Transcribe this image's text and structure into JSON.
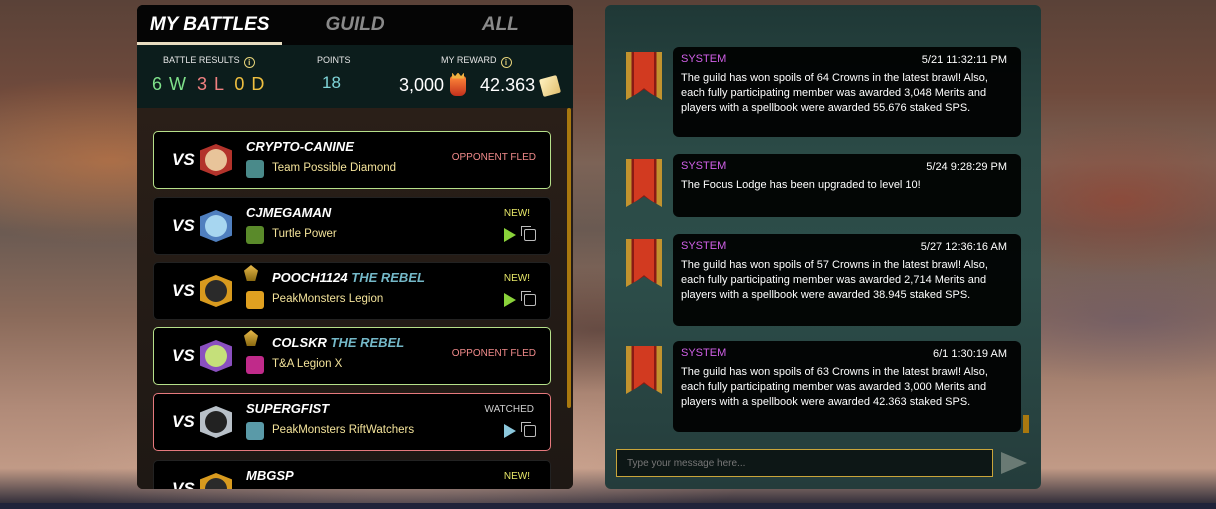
{
  "tabs": [
    "MY BATTLES",
    "GUILD",
    "ALL"
  ],
  "summary": {
    "battle_results_label": "BATTLE RESULTS",
    "wins": "6 W",
    "losses": "3 L",
    "draws": "0 D",
    "points_label": "POINTS",
    "points": "18",
    "reward_label": "MY REWARD",
    "reward_crowns": "3,000",
    "reward_sps": "42.363",
    "colors": {
      "wins": "#7fe08a",
      "losses": "#f08080",
      "draws": "#f0c040"
    }
  },
  "battles": [
    {
      "vs": "VS",
      "name": "CRYPTO-CANINE",
      "title": "",
      "guild": "Team Possible Diamond",
      "status": "OPPONENT FLED"
    },
    {
      "vs": "VS",
      "name": "CJMEGAMAN",
      "title": "",
      "guild": "Turtle Power",
      "status": "NEW!"
    },
    {
      "vs": "VS",
      "name": "POOCH1124",
      "title": "THE REBEL",
      "guild": "PeakMonsters Legion",
      "status": "NEW!"
    },
    {
      "vs": "VS",
      "name": "COLSKR",
      "title": "THE REBEL",
      "guild": "T&A Legion X",
      "status": "OPPONENT FLED"
    },
    {
      "vs": "VS",
      "name": "SUPERGFIST",
      "title": "",
      "guild": "PeakMonsters RiftWatchers",
      "status": "WATCHED"
    },
    {
      "vs": "VS",
      "name": "MBGSP",
      "title": "",
      "guild": "",
      "status": "NEW!"
    }
  ],
  "chat": {
    "messages": [
      {
        "sender": "SYSTEM",
        "time": "5/21 11:32:11 PM",
        "text": "The guild has won spoils of 64 Crowns in the latest brawl! Also, each fully participating member was awarded 3,048 Merits and players with a spellbook were awarded 55.676 staked SPS."
      },
      {
        "sender": "SYSTEM",
        "time": "5/24 9:28:29 PM",
        "text": "The Focus Lodge has been upgraded to level 10!"
      },
      {
        "sender": "SYSTEM",
        "time": "5/27 12:36:16 AM",
        "text": "The guild has won spoils of 57 Crowns in the latest brawl! Also, each fully participating member was awarded 2,714 Merits and players with a spellbook were awarded 38.945 staked SPS."
      },
      {
        "sender": "SYSTEM",
        "time": "6/1 1:30:19 AM",
        "text": "The guild has won spoils of 63 Crowns in the latest brawl! Also, each fully participating member was awarded 3,000 Merits and players with a spellbook were awarded 42.363 staked SPS."
      }
    ],
    "input_placeholder": "Type your message here..."
  }
}
